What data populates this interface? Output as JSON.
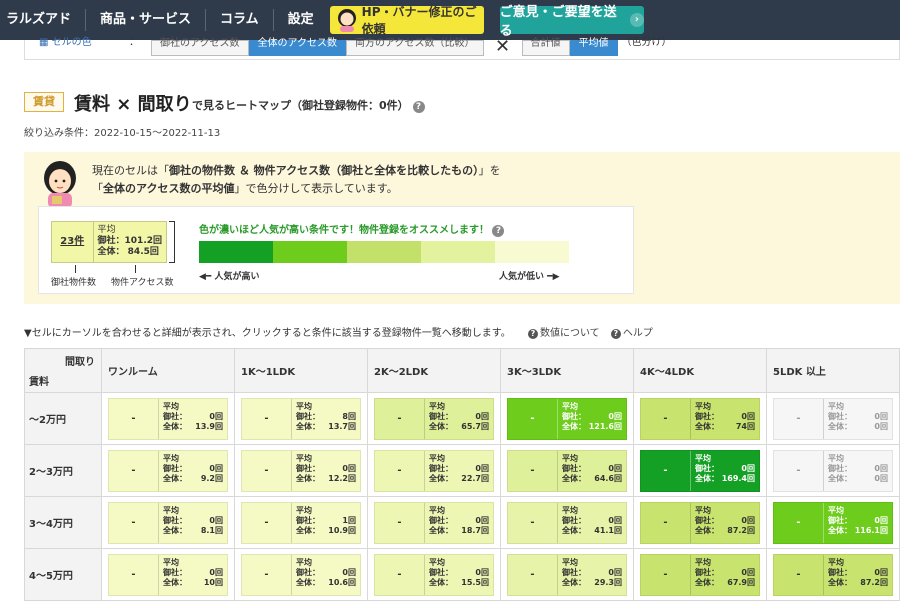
{
  "nav": {
    "logo": "ラルズアド",
    "items": [
      "商品・サービス",
      "コラム",
      "設定"
    ],
    "banner_btn": "HP・バナー修正のご依頼",
    "request_btn": "ご意見・ご要望を送る"
  },
  "filterbar": {
    "label": "セルの色",
    "colon": "：",
    "buttons": [
      "御社のアクセス数",
      "全体のアクセス数",
      "両方のアクセス数（比較）"
    ],
    "close": "✕",
    "buttons2": [
      "合計値",
      "平均値"
    ],
    "suffix": "（色分け）"
  },
  "heading": {
    "badge": "賃貸",
    "title": "賃料 × 間取り",
    "subtitle": "で見るヒートマップ（御社登録物件：0件）",
    "filter_cond": "絞り込み条件：2022-10-15～2022-11-13"
  },
  "explain": {
    "line1_pre": "現在のセルは「",
    "line1_bold": "御社の物件数 ＆ 物件アクセス数（御社と全体を比較したもの）",
    "line1_post": "」を",
    "line2_pre": "「",
    "line2_bold": "全体のアクセス数の平均値",
    "line2_post": "」で色分けして表示しています。",
    "legend_count": "23件",
    "legend_avg_title": "平均",
    "legend_avg_own": "御社：101.2回",
    "legend_avg_all": "全体： 84.5回",
    "legend_label_count": "御社物件数",
    "legend_label_access": "物件アクセス数",
    "headline": "色が濃いほど人気が高い条件です！物件登録をオススメします！",
    "pop_high": "人気が高い",
    "pop_low": "人気が低い",
    "scale_colors": [
      "#13a024",
      "#6dcc1c",
      "#c3e06a",
      "#e2f29e",
      "#f8fbd2"
    ]
  },
  "hover_note": {
    "text": "▼セルにカーソルを合わせると詳細が表示され、クリックすると条件に該当する登録物件一覧へ移動します。",
    "link1": "数値について",
    "link2": "ヘルプ"
  },
  "table": {
    "corner_top": "間取り",
    "corner_bottom": "賃料",
    "columns": [
      "ワンルーム",
      "1K～1LDK",
      "2K～2LDK",
      "3K～3LDK",
      "4K～4LDK",
      "5LDK 以上"
    ],
    "avg_label": "平均",
    "own_label": "御社：",
    "all_label": "全体：",
    "rows": [
      {
        "label": "～2万円",
        "cells": [
          {
            "count": "-",
            "own": "0回",
            "all": "13.9回",
            "color": "#f5f9c4"
          },
          {
            "count": "-",
            "own": "8回",
            "all": "13.7回",
            "color": "#f5f9c4"
          },
          {
            "count": "-",
            "own": "0回",
            "all": "65.7回",
            "color": "#dff09a"
          },
          {
            "count": "-",
            "own": "0回",
            "all": "121.6回",
            "color": "#6dcc1c"
          },
          {
            "count": "-",
            "own": "0回",
            "all": "74回",
            "color": "#c8e46e"
          },
          {
            "count": "-",
            "own": "0回",
            "all": "0回",
            "color": "#f6f6f6"
          }
        ]
      },
      {
        "label": "2～3万円",
        "cells": [
          {
            "count": "-",
            "own": "0回",
            "all": "9.2回",
            "color": "#f5f9c4"
          },
          {
            "count": "-",
            "own": "0回",
            "all": "12.2回",
            "color": "#f5f9c4"
          },
          {
            "count": "-",
            "own": "0回",
            "all": "22.7回",
            "color": "#eef6b4"
          },
          {
            "count": "-",
            "own": "0回",
            "all": "64.6回",
            "color": "#dff09a"
          },
          {
            "count": "-",
            "own": "0回",
            "all": "169.4回",
            "color": "#13a024"
          },
          {
            "count": "-",
            "own": "0回",
            "all": "0回",
            "color": "#f6f6f6"
          }
        ]
      },
      {
        "label": "3～4万円",
        "cells": [
          {
            "count": "-",
            "own": "0回",
            "all": "8.1回",
            "color": "#f5f9c4"
          },
          {
            "count": "-",
            "own": "1回",
            "all": "10.9回",
            "color": "#f5f9c4"
          },
          {
            "count": "-",
            "own": "0回",
            "all": "18.7回",
            "color": "#eef6b4"
          },
          {
            "count": "-",
            "own": "0回",
            "all": "41.1回",
            "color": "#e6f3a8"
          },
          {
            "count": "-",
            "own": "0回",
            "all": "87.2回",
            "color": "#c8e46e"
          },
          {
            "count": "-",
            "own": "0回",
            "all": "116.1回",
            "color": "#6dcc1c"
          }
        ]
      },
      {
        "label": "4～5万円",
        "cells": [
          {
            "count": "-",
            "own": "0回",
            "all": "10回",
            "color": "#f5f9c4"
          },
          {
            "count": "-",
            "own": "0回",
            "all": "10.6回",
            "color": "#f5f9c4"
          },
          {
            "count": "-",
            "own": "0回",
            "all": "15.5回",
            "color": "#eef6b4"
          },
          {
            "count": "-",
            "own": "0回",
            "all": "29.3回",
            "color": "#e6f3a8"
          },
          {
            "count": "-",
            "own": "0回",
            "all": "67.9回",
            "color": "#c8e46e"
          },
          {
            "count": "-",
            "own": "0回",
            "all": "87.2回",
            "color": "#c8e46e"
          }
        ]
      }
    ]
  }
}
